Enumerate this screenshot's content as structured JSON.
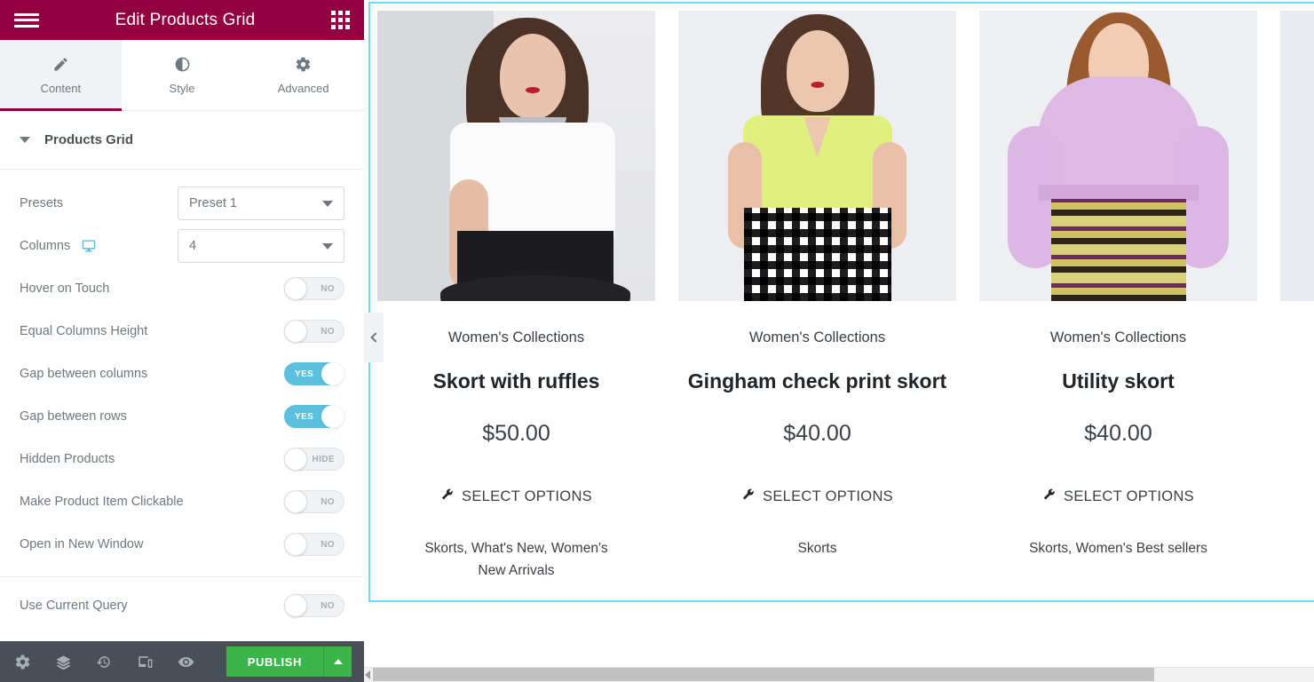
{
  "panel": {
    "header": {
      "title": "Edit Products Grid",
      "menu_icon": "hamburger-icon",
      "apps_icon": "widgets-grid-icon"
    },
    "tabs": [
      {
        "label": "Content",
        "icon": "pencil-icon",
        "active": true
      },
      {
        "label": "Style",
        "icon": "contrast-half-circle-icon",
        "active": false
      },
      {
        "label": "Advanced",
        "icon": "gear-icon",
        "active": false
      }
    ],
    "section": {
      "title": "Products Grid",
      "toggle_icon": "caret-down-icon"
    },
    "controls": [
      {
        "label": "Presets",
        "type": "select",
        "value": "Preset 1",
        "device_icon": null
      },
      {
        "label": "Columns",
        "type": "select",
        "value": "4",
        "device_icon": "desktop-monitor-icon"
      },
      {
        "label": "Hover on Touch",
        "type": "switch",
        "state": "NO",
        "on": false
      },
      {
        "label": "Equal Columns Height",
        "type": "switch",
        "state": "NO",
        "on": false
      },
      {
        "label": "Gap between columns",
        "type": "switch",
        "state": "YES",
        "on": true
      },
      {
        "label": "Gap between rows",
        "type": "switch",
        "state": "YES",
        "on": true
      },
      {
        "label": "Hidden Products",
        "type": "switch",
        "state": "HIDE",
        "on": false
      },
      {
        "label": "Make Product Item Clickable",
        "type": "switch",
        "state": "NO",
        "on": false
      },
      {
        "label": "Open in New Window",
        "type": "switch",
        "state": "NO",
        "on": false
      }
    ],
    "controls_after_divider": [
      {
        "label": "Use Current Query",
        "type": "switch",
        "state": "NO",
        "on": false
      }
    ],
    "footer": {
      "icons": [
        {
          "name": "settings-gear-icon"
        },
        {
          "name": "navigator-layers-icon"
        },
        {
          "name": "history-clock-icon"
        },
        {
          "name": "responsive-devices-icon"
        },
        {
          "name": "preview-eye-icon"
        }
      ],
      "publish_label": "PUBLISH",
      "publish_arrow_icon": "caret-up-icon",
      "publish_color": "#39b54a"
    }
  },
  "canvas": {
    "collapse_handle_icon": "chevron-left-icon",
    "selection_border_color": "#71d7f7",
    "products": [
      {
        "category": "Women's Collections",
        "name": "Skort with ruffles",
        "price": "$50.00",
        "action_label": "SELECT OPTIONS",
        "action_icon": "wrench-icon",
        "tags": "Skorts, What's New, Women's New Arrivals"
      },
      {
        "category": "Women's Collections",
        "name": "Gingham check print skort",
        "price": "$40.00",
        "action_label": "SELECT OPTIONS",
        "action_icon": "wrench-icon",
        "tags": "Skorts"
      },
      {
        "category": "Women's Collections",
        "name": "Utility skort",
        "price": "$40.00",
        "action_label": "SELECT OPTIONS",
        "action_icon": "wrench-icon",
        "tags": "Skorts, Women's Best sellers"
      }
    ]
  },
  "theme": {
    "header_bg": "#93003f",
    "toggle_on": "#5bc0de",
    "footer_bg": "#4a4f57"
  }
}
